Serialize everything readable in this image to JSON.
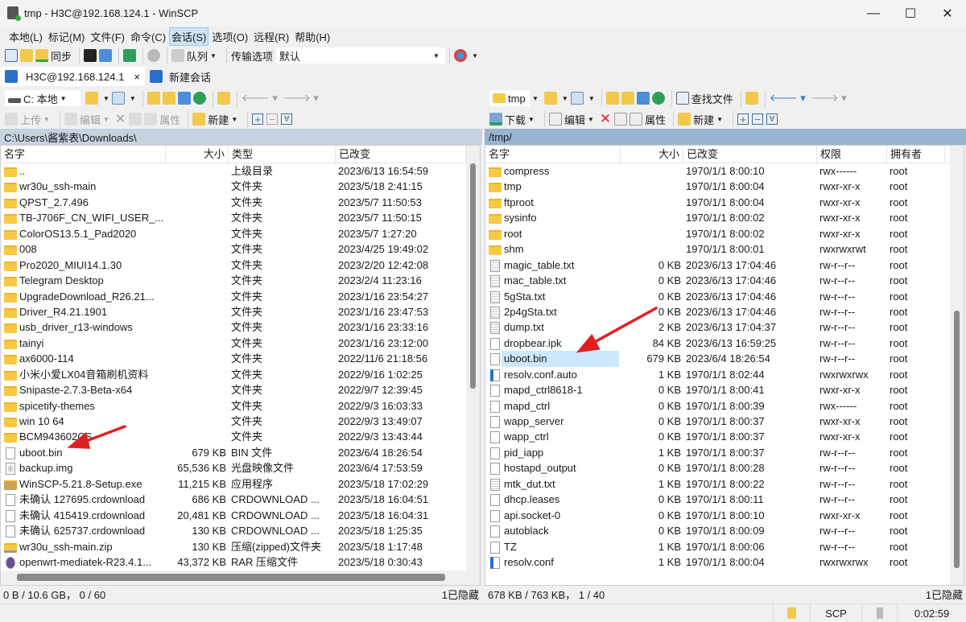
{
  "window": {
    "title": "tmp - H3C@192.168.124.1 - WinSCP"
  },
  "menu": [
    "本地(L)",
    "标记(M)",
    "文件(F)",
    "命令(C)",
    "会话(S)",
    "选项(O)",
    "远程(R)",
    "帮助(H)"
  ],
  "menu_active_index": 4,
  "toolbar": {
    "sync": "同步",
    "queue": "队列",
    "transfer_label": "传输选项",
    "transfer_value": "默认"
  },
  "tabs": [
    {
      "label": "H3C@192.168.124.1",
      "close": "×"
    },
    {
      "label": "新建会话"
    }
  ],
  "left": {
    "drive": "C: 本地",
    "upload": "上传",
    "edit": "编辑",
    "properties": "属性",
    "new": "新建",
    "path": "C:\\Users\\酱紫表\\Downloads\\",
    "columns": [
      "名字",
      "大小",
      "类型",
      "已改变"
    ],
    "rows": [
      [
        "..",
        "",
        "上级目录",
        "2023/6/13  16:54:59",
        "up"
      ],
      [
        "wr30u_ssh-main",
        "",
        "文件夹",
        "2023/5/18  2:41:15",
        "folder"
      ],
      [
        "QPST_2.7.496",
        "",
        "文件夹",
        "2023/5/7  11:50:53",
        "folder"
      ],
      [
        "TB-J706F_CN_WIFI_USER_...",
        "",
        "文件夹",
        "2023/5/7  11:50:15",
        "folder"
      ],
      [
        "ColorOS13.5.1_Pad2020",
        "",
        "文件夹",
        "2023/5/7  1:27:20",
        "folder"
      ],
      [
        "008",
        "",
        "文件夹",
        "2023/4/25  19:49:02",
        "folder"
      ],
      [
        "Pro2020_MIUI14.1.30",
        "",
        "文件夹",
        "2023/2/20  12:42:08",
        "folder"
      ],
      [
        "Telegram Desktop",
        "",
        "文件夹",
        "2023/2/4  11:23:16",
        "folder"
      ],
      [
        "UpgradeDownload_R26.21...",
        "",
        "文件夹",
        "2023/1/16  23:54:27",
        "folder"
      ],
      [
        "Driver_R4.21.1901",
        "",
        "文件夹",
        "2023/1/16  23:47:53",
        "folder"
      ],
      [
        "usb_driver_r13-windows",
        "",
        "文件夹",
        "2023/1/16  23:33:16",
        "folder"
      ],
      [
        "tainyi",
        "",
        "文件夹",
        "2023/1/16  23:12:00",
        "folder"
      ],
      [
        "ax6000-114",
        "",
        "文件夹",
        "2022/11/6  21:18:56",
        "folder"
      ],
      [
        "小米小爱LX04音箱刷机资料",
        "",
        "文件夹",
        "2022/9/16  1:02:25",
        "folder"
      ],
      [
        "Snipaste-2.7.3-Beta-x64",
        "",
        "文件夹",
        "2022/9/7  12:39:45",
        "folder"
      ],
      [
        "spicetify-themes",
        "",
        "文件夹",
        "2022/9/3  16:03:33",
        "folder"
      ],
      [
        "win 10 64",
        "",
        "文件夹",
        "2022/9/3  13:49:07",
        "folder"
      ],
      [
        "BCM943602CS",
        "",
        "文件夹",
        "2022/9/3  13:43:44",
        "folder"
      ],
      [
        "uboot.bin",
        "679 KB",
        "BIN 文件",
        "2023/6/4  18:26:54",
        "file"
      ],
      [
        "backup.img",
        "65,536 KB",
        "光盘映像文件",
        "2023/6/4  17:53:59",
        "disc"
      ],
      [
        "WinSCP-5.21.8-Setup.exe",
        "11,215 KB",
        "应用程序",
        "2023/5/18  17:02:29",
        "exe"
      ],
      [
        "未确认 127695.crdownload",
        "686 KB",
        "CRDOWNLOAD ...",
        "2023/5/18  16:04:51",
        "file"
      ],
      [
        "未确认 415419.crdownload",
        "20,481 KB",
        "CRDOWNLOAD ...",
        "2023/5/18  16:04:31",
        "file"
      ],
      [
        "未确认 625737.crdownload",
        "130 KB",
        "CRDOWNLOAD ...",
        "2023/5/18  1:25:35",
        "file"
      ],
      [
        "wr30u_ssh-main.zip",
        "130 KB",
        "压缩(zipped)文件夹",
        "2023/5/18  1:17:48",
        "zip"
      ],
      [
        "openwrt-mediatek-R23.4.1...",
        "43,372 KB",
        "RAR 压缩文件",
        "2023/5/18  0:30:43",
        "rar"
      ]
    ],
    "status_left": "0 B / 10.6 GB， 0 / 60",
    "status_right": "1已隐藏"
  },
  "right": {
    "dir": "tmp",
    "find": "查找文件",
    "download": "下载",
    "edit": "编辑",
    "properties": "属性",
    "new": "新建",
    "path": "/tmp/",
    "columns": [
      "名字",
      "大小",
      "已改变",
      "权限",
      "拥有者"
    ],
    "selected_index": 12,
    "rows": [
      [
        "compress",
        "",
        "1970/1/1 8:00:10",
        "rwx------",
        "root",
        "folder"
      ],
      [
        "tmp",
        "",
        "1970/1/1 8:00:04",
        "rwxr-xr-x",
        "root",
        "folder"
      ],
      [
        "ftproot",
        "",
        "1970/1/1 8:00:04",
        "rwxr-xr-x",
        "root",
        "folder"
      ],
      [
        "sysinfo",
        "",
        "1970/1/1 8:00:02",
        "rwxr-xr-x",
        "root",
        "folder"
      ],
      [
        "root",
        "",
        "1970/1/1 8:00:02",
        "rwxr-xr-x",
        "root",
        "folder"
      ],
      [
        "shm",
        "",
        "1970/1/1 8:00:01",
        "rwxrwxrwt",
        "root",
        "folder"
      ],
      [
        "magic_table.txt",
        "0 KB",
        "2023/6/13 17:04:46",
        "rw-r--r--",
        "root",
        "txt"
      ],
      [
        "mac_table.txt",
        "0 KB",
        "2023/6/13 17:04:46",
        "rw-r--r--",
        "root",
        "txt"
      ],
      [
        "5gSta.txt",
        "0 KB",
        "2023/6/13 17:04:46",
        "rw-r--r--",
        "root",
        "txt"
      ],
      [
        "2p4gSta.txt",
        "0 KB",
        "2023/6/13 17:04:46",
        "rw-r--r--",
        "root",
        "txt"
      ],
      [
        "dump.txt",
        "2 KB",
        "2023/6/13 17:04:37",
        "rw-r--r--",
        "root",
        "txt"
      ],
      [
        "dropbear.ipk",
        "84 KB",
        "2023/6/13 16:59:25",
        "rw-r--r--",
        "root",
        "file"
      ],
      [
        "uboot.bin",
        "679 KB",
        "2023/6/4 18:26:54",
        "rw-r--r--",
        "root",
        "file"
      ],
      [
        "resolv.conf.auto",
        "1 KB",
        "1970/1/1 8:02:44",
        "rwxrwxrwx",
        "root",
        "link"
      ],
      [
        "mapd_ctrl8618-1",
        "0 KB",
        "1970/1/1 8:00:41",
        "rwxr-xr-x",
        "root",
        "file"
      ],
      [
        "mapd_ctrl",
        "0 KB",
        "1970/1/1 8:00:39",
        "rwx------",
        "root",
        "file"
      ],
      [
        "wapp_server",
        "0 KB",
        "1970/1/1 8:00:37",
        "rwxr-xr-x",
        "root",
        "file"
      ],
      [
        "wapp_ctrl",
        "0 KB",
        "1970/1/1 8:00:37",
        "rwxr-xr-x",
        "root",
        "file"
      ],
      [
        "pid_iapp",
        "1 KB",
        "1970/1/1 8:00:37",
        "rw-r--r--",
        "root",
        "file"
      ],
      [
        "hostapd_output",
        "0 KB",
        "1970/1/1 8:00:28",
        "rw-r--r--",
        "root",
        "file"
      ],
      [
        "mtk_dut.txt",
        "1 KB",
        "1970/1/1 8:00:22",
        "rw-r--r--",
        "root",
        "txt"
      ],
      [
        "dhcp.leases",
        "0 KB",
        "1970/1/1 8:00:11",
        "rw-r--r--",
        "root",
        "file"
      ],
      [
        "api.socket-0",
        "0 KB",
        "1970/1/1 8:00:10",
        "rwxr-xr-x",
        "root",
        "file"
      ],
      [
        "autoblack",
        "0 KB",
        "1970/1/1 8:00:09",
        "rw-r--r--",
        "root",
        "file"
      ],
      [
        "TZ",
        "1 KB",
        "1970/1/1 8:00:06",
        "rw-r--r--",
        "root",
        "file"
      ],
      [
        "resolv.conf",
        "1 KB",
        "1970/1/1 8:00:04",
        "rwxrwxrwx",
        "root",
        "link"
      ]
    ],
    "status_left": "678 KB / 763 KB， 1 / 40",
    "status_right": "1已隐藏"
  },
  "bottom": {
    "protocol": "SCP",
    "elapsed": "0:02:59"
  },
  "colors": {
    "active_path": "#99b4d1",
    "inactive_path": "#c6d2df",
    "selection": "#cce8ff",
    "arrow": "#e02020",
    "folder": "#f8c942"
  }
}
